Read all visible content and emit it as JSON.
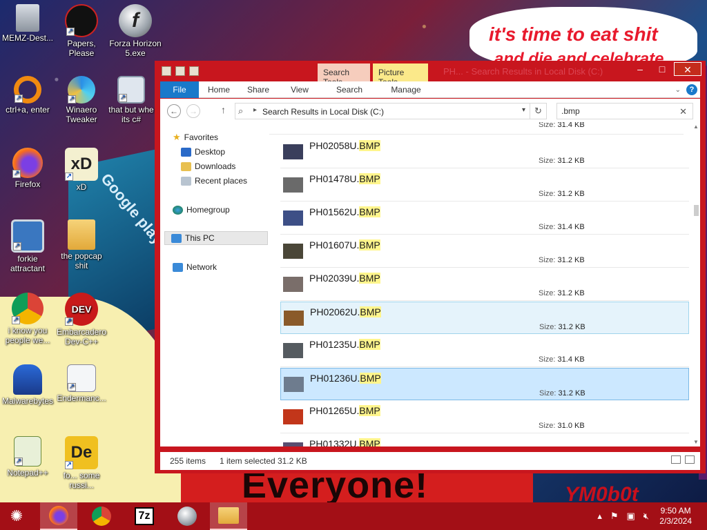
{
  "desktop": {
    "icons": [
      {
        "label": "MEMZ-Dest...",
        "icon": "recycle-bin-icon"
      },
      {
        "label": "Papers, Please",
        "icon": "papers-please-icon"
      },
      {
        "label": "Forza Horizon 5.exe",
        "icon": "flash-icon"
      },
      {
        "label": "ctrl+a, enter",
        "icon": "orange-ring-icon"
      },
      {
        "label": "Winaero Tweaker",
        "icon": "winaero-icon"
      },
      {
        "label": "that but whe its c#",
        "icon": "windows-stack-icon"
      },
      {
        "label": "Firefox",
        "icon": "firefox-icon"
      },
      {
        "label": "xD",
        "icon": "xd-icon"
      },
      {
        "label": "forkie attractant",
        "icon": "monitor-gear-icon"
      },
      {
        "label": "the popcap shit",
        "icon": "folder-icon"
      },
      {
        "label": "i know you people we...",
        "icon": "chrome-icon"
      },
      {
        "label": "Embarcadero Dev-C++",
        "icon": "devcpp-icon"
      },
      {
        "label": "Malwarebytes",
        "icon": "malwarebytes-icon"
      },
      {
        "label": "Endermanc...",
        "icon": "document-chart-icon"
      },
      {
        "label": "Notepad++",
        "icon": "notepadpp-icon"
      },
      {
        "label": "fo... some russi...",
        "icon": "de-icon"
      }
    ],
    "wallpaper_texts": {
      "bubble_line1": "it's time to eat shit",
      "bubble_line2": "and die and celebrate",
      "banner": "Everyone!",
      "corner": "YM0b0t",
      "sign": "Google play"
    }
  },
  "explorer": {
    "title": "PH... - Search Results in Local Disk (C:)",
    "context_tabs": {
      "search_tools": "Search Tools",
      "picture_tools": "Picture Tools"
    },
    "ribbon_tabs": {
      "file": "File",
      "home": "Home",
      "share": "Share",
      "view": "View",
      "search": "Search",
      "manage": "Manage"
    },
    "address": {
      "path": "Search Results in Local Disk (C:)"
    },
    "search": {
      "value": ".bmp"
    },
    "nav": {
      "favorites": "Favorites",
      "desktop": "Desktop",
      "downloads": "Downloads",
      "recent": "Recent places",
      "homegroup": "Homegroup",
      "thispc": "This PC",
      "network": "Network"
    },
    "size_label": "Size:",
    "partial_size": "31.4 KB",
    "files": [
      {
        "name": "PH02058U.",
        "ext": "BMP",
        "size": "31.2 KB",
        "thumb": "#3a3f5c"
      },
      {
        "name": "PH01478U.",
        "ext": "BMP",
        "size": "31.2 KB",
        "thumb": "#6a6a6a"
      },
      {
        "name": "PH01562U.",
        "ext": "BMP",
        "size": "31.4 KB",
        "thumb": "#3d4f86"
      },
      {
        "name": "PH01607U.",
        "ext": "BMP",
        "size": "31.2 KB",
        "thumb": "#4a4638"
      },
      {
        "name": "PH02039U.",
        "ext": "BMP",
        "size": "31.2 KB",
        "thumb": "#7a6e6a"
      },
      {
        "name": "PH02062U.",
        "ext": "BMP",
        "size": "31.2 KB",
        "thumb": "#8a5a2a"
      },
      {
        "name": "PH01235U.",
        "ext": "BMP",
        "size": "31.4 KB",
        "thumb": "#555b60"
      },
      {
        "name": "PH01236U.",
        "ext": "BMP",
        "size": "31.2 KB",
        "thumb": "#6e7c8e"
      },
      {
        "name": "PH01265U.",
        "ext": "BMP",
        "size": "31.0 KB",
        "thumb": "#c2361a"
      },
      {
        "name": "PH01332U.",
        "ext": "BMP",
        "size": "",
        "thumb": "#5a4e70"
      }
    ],
    "status": {
      "items": "255 items",
      "selected": "1 item selected",
      "size": "31.2 KB"
    }
  },
  "taskbar": {
    "apps": [
      "firefox-icon",
      "chrome-icon",
      "7zip-icon",
      "flash-icon",
      "file-explorer-icon"
    ],
    "seven_zip_label": "7z",
    "clock": {
      "time": "9:50 AM",
      "date": "2/3/2024"
    }
  },
  "colors": {
    "window_frame": "#c8161e",
    "taskbar": "#a30f16",
    "file_tab": "#1979ca",
    "selected_row": "#cce8ff",
    "highlight": "#fff58c"
  }
}
